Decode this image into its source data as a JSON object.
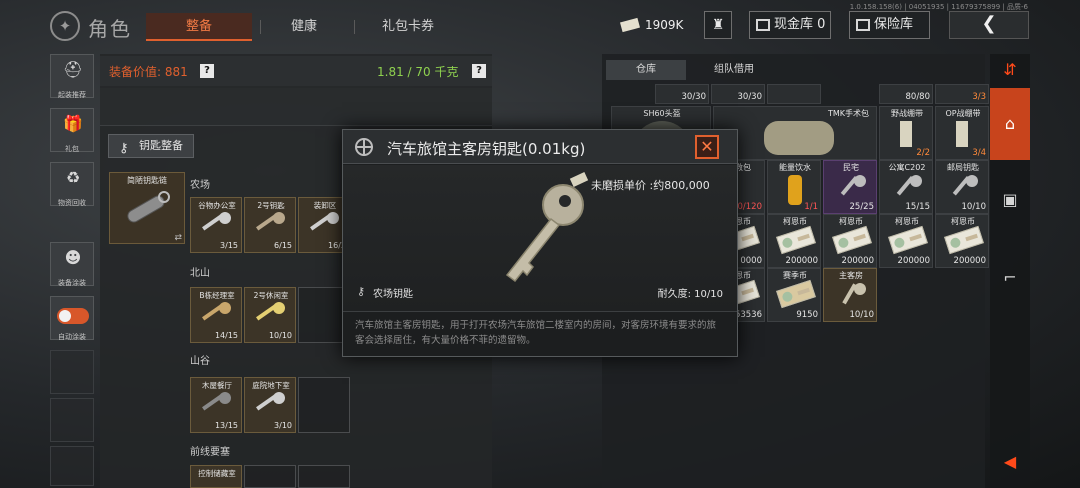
{
  "build_info": "1.0.158.158(6) | 04051935 | 11679375899 | 品质-6",
  "header": {
    "title": "角色",
    "tabs": [
      {
        "label": "整备",
        "active": true
      },
      {
        "label": "健康",
        "active": false
      },
      {
        "label": "礼包卡券",
        "active": false
      }
    ],
    "money": "1909K",
    "cash_vault": "现金库 0",
    "safe_box": "保险库"
  },
  "sidebar": {
    "items": [
      {
        "label": "起装推荐",
        "icon": "recommend-icon"
      },
      {
        "label": "礼包",
        "icon": "gift-icon"
      },
      {
        "label": "物资回收",
        "icon": "recycle-icon"
      },
      {
        "label": "装备涂装",
        "icon": "paint-icon"
      },
      {
        "label": "自动涂装",
        "icon": "toggle-icon"
      }
    ]
  },
  "loadout": {
    "value_label": "装备价值: 881",
    "weight": "1.81 / 70 千克",
    "keys_button": "钥匙整备",
    "keychain_name": "简陋钥匙链",
    "sections": [
      {
        "title": "农场",
        "keys": [
          {
            "name": "谷物办公室",
            "count": "3/15"
          },
          {
            "name": "2号钥匙",
            "count": "6/15"
          },
          {
            "name": "装卸区",
            "count": "16/2"
          }
        ]
      },
      {
        "title": "北山",
        "keys": [
          {
            "name": "B栋经理室",
            "count": "14/15"
          },
          {
            "name": "2号休闲室",
            "count": "10/10"
          }
        ]
      },
      {
        "title": "山谷",
        "keys": [
          {
            "name": "木屋餐厅",
            "count": "13/15"
          },
          {
            "name": "庭院地下室",
            "count": "3/10"
          }
        ]
      },
      {
        "title": "前线要塞",
        "keys": [
          {
            "name": "控制储藏室",
            "count": ""
          }
        ]
      }
    ]
  },
  "inventory": {
    "tabs": [
      {
        "label": "仓库",
        "active": true
      },
      {
        "label": "组队借用",
        "active": false
      }
    ],
    "row0": [
      {
        "name": "",
        "count": "30/30"
      },
      {
        "name": "",
        "count": "30/30"
      },
      {
        "name": "",
        "count": ""
      },
      {
        "name": "",
        "count": "80/80"
      },
      {
        "name": "",
        "count": "3/3"
      }
    ],
    "row1": [
      {
        "name": "SH60头盔",
        "count": ""
      },
      {
        "name": "TMK手术包",
        "count": ""
      },
      {
        "name": "野战绷带",
        "count": "2/2"
      },
      {
        "name": "OP战绷带",
        "count": "3/4"
      }
    ],
    "row2": [
      {
        "name": "急救包",
        "count": "20/120"
      },
      {
        "name": "能量饮水",
        "count": "1/1"
      },
      {
        "name": "民宅",
        "count": "25/25"
      },
      {
        "name": "公寓C202",
        "count": "15/15"
      },
      {
        "name": "邮局钥匙",
        "count": "10/10"
      }
    ],
    "row3": [
      {
        "name": "柯恩币",
        "count": "0000"
      },
      {
        "name": "柯恩币",
        "count": "200000"
      },
      {
        "name": "柯恩币",
        "count": "200000"
      },
      {
        "name": "柯恩币",
        "count": "200000"
      },
      {
        "name": "柯恩币",
        "count": "200000"
      }
    ],
    "row4": [
      {
        "name": "柯恩币",
        "count": "53536"
      },
      {
        "name": "赛季币",
        "count": "9150"
      },
      {
        "name": "主客房",
        "count": "10/10"
      }
    ]
  },
  "modal": {
    "title": "汽车旅馆主客房钥匙(0.01kg)",
    "price": "未磨损单价 :约800,000",
    "key_type": "农场钥匙",
    "durability": "耐久度: 10/10",
    "description": "汽车旅馆主客房钥匙，用于打开农场汽车旅馆二楼室内的房间，对客房环境有要求的旅客会选择居住，有大量价格不菲的遗留物。"
  },
  "colors": {
    "accent": "#e0602e",
    "weight_green": "#8fd14f",
    "warning_red": "#ff5555"
  }
}
